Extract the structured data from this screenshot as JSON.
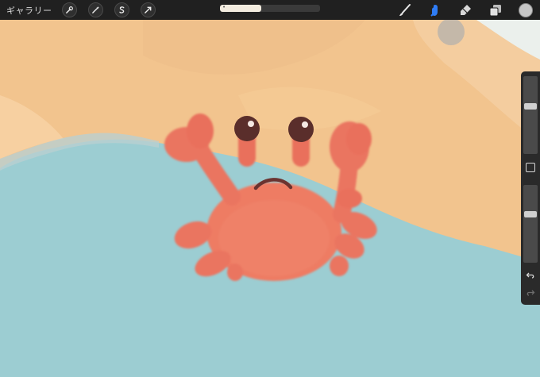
{
  "topbar": {
    "gallery_label": "ギャラリー",
    "left_tools": [
      {
        "name": "actions",
        "icon": "wrench-icon"
      },
      {
        "name": "adjustments",
        "icon": "magic-wand-icon"
      },
      {
        "name": "selection",
        "icon": "selection-s-icon"
      },
      {
        "name": "transform",
        "icon": "arrow-cursor-icon"
      }
    ],
    "progress": {
      "text": "•",
      "value": 0.41
    },
    "right_tools": [
      {
        "name": "brush",
        "icon": "brush-icon"
      },
      {
        "name": "smudge",
        "icon": "smudge-finger-icon",
        "active": true
      },
      {
        "name": "eraser",
        "icon": "eraser-icon"
      },
      {
        "name": "layers",
        "icon": "layers-icon"
      },
      {
        "name": "color",
        "icon": "color-swatch-icon"
      }
    ]
  },
  "sidebar": {
    "brush_size": 0.38,
    "opacity": 0.37
  },
  "colors": {
    "active_tool": "#2f7df6",
    "water": "#9ccdd2",
    "sand": "#f2c48e",
    "crab": "#ef7c62",
    "toolbar_bg": "#202020"
  }
}
